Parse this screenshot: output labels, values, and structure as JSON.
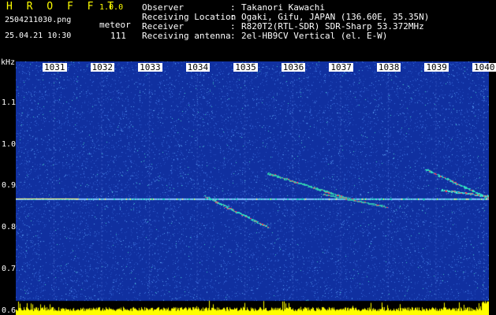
{
  "header": {
    "app_title": "H R O F F T",
    "version": "1.0.0",
    "file_name": "2504211030.png",
    "meteor_label": "meteor",
    "datetime": "25.04.21 10:30",
    "meteor_count": "111",
    "info": [
      {
        "key": "Observer",
        "value": "Takanori Kawachi"
      },
      {
        "key": "Receiving Location",
        "value": "Ogaki, Gifu, JAPAN (136.60E, 35.35N)"
      },
      {
        "key": "Receiver",
        "value": "R820T2(RTL-SDR) SDR-Sharp 53.372MHz"
      },
      {
        "key": "Receiving antenna",
        "value": "2el-HB9CV Vertical (el. E-W)"
      }
    ]
  },
  "chart_data": {
    "type": "heatmap",
    "title": "",
    "ylabel": "kHz",
    "xlabel": "",
    "x_ticks": [
      "1031",
      "1032",
      "1033",
      "1034",
      "1035",
      "1036",
      "1037",
      "1038",
      "1039",
      "1040"
    ],
    "y_ticks": [
      "1.1",
      "1.0",
      "0.9",
      "0.8",
      "0.7",
      "0.6"
    ],
    "ylim": [
      0.59,
      1.2
    ],
    "carrier_khz": 0.87,
    "colors": {
      "background": "#1030a0",
      "noise": "#3060d0",
      "signal_low": "#20d0c0",
      "signal_high": "#ff4060",
      "level_bar": "#ffff00"
    }
  }
}
